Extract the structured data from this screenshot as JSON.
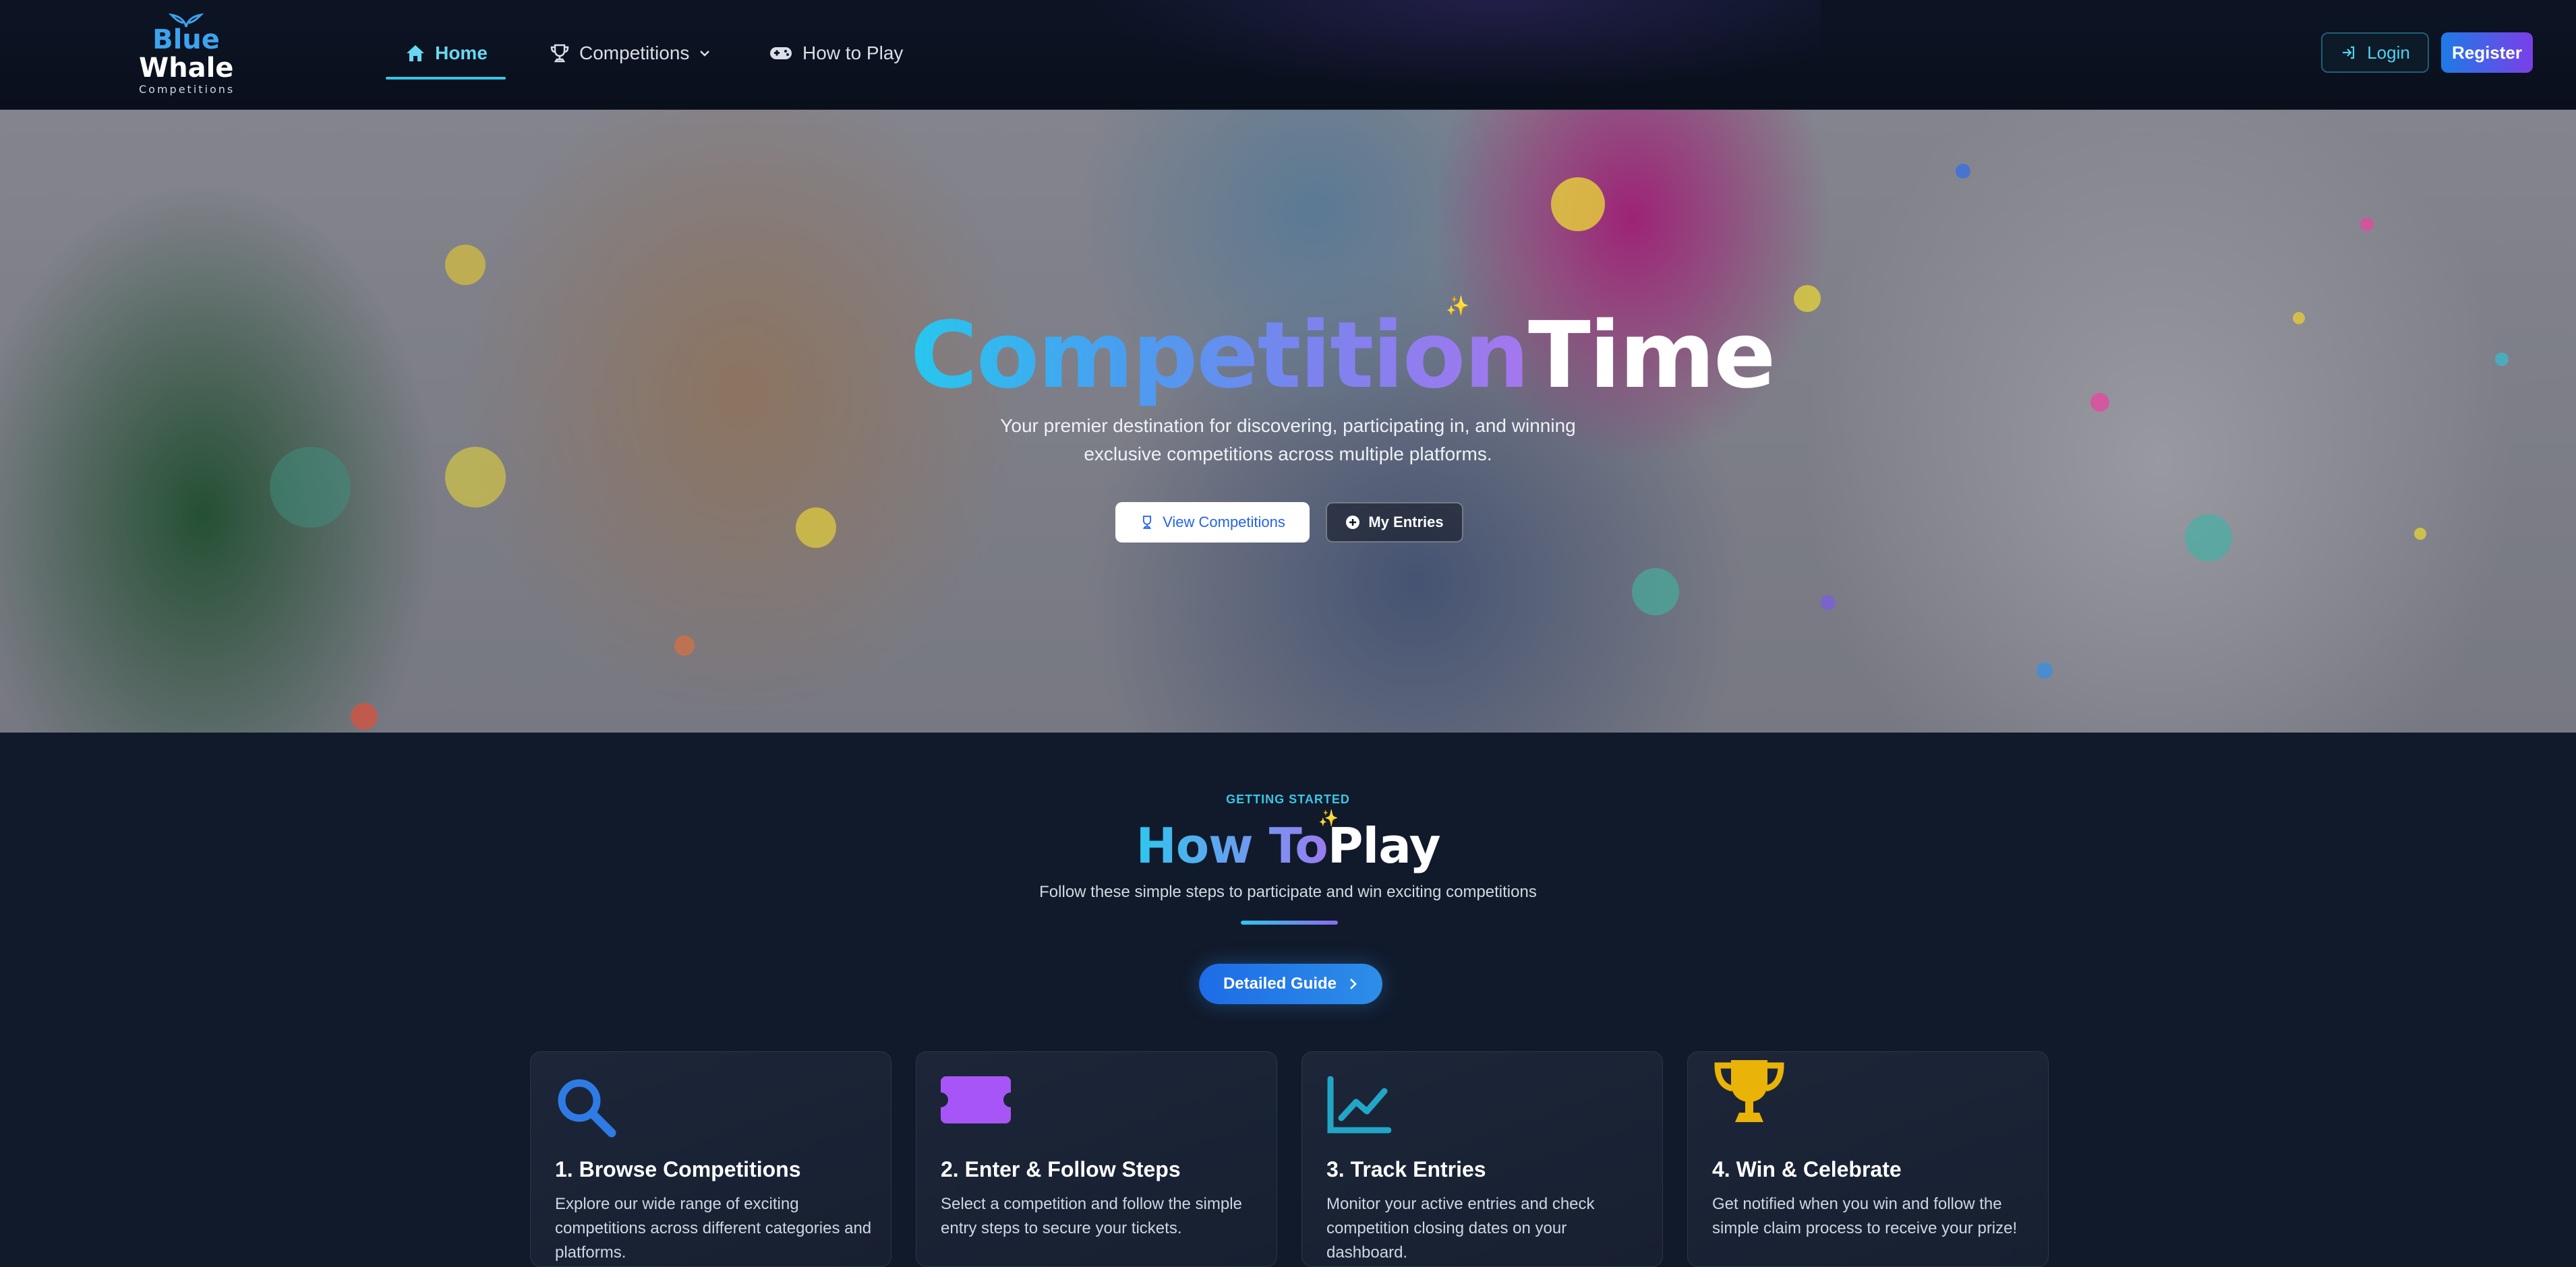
{
  "brand": {
    "line1": "Blue",
    "line2": "Whale",
    "line3": "Competitions"
  },
  "nav": {
    "home": "Home",
    "competitions": "Competitions",
    "how_to_play": "How to Play",
    "login": "Login",
    "register": "Register"
  },
  "hero": {
    "title_part1": "Competition",
    "title_part2": "Time",
    "subtitle": "Your premier destination for discovering, participating in, and winning exclusive competitions across multiple platforms.",
    "primary_button": "View Competitions",
    "secondary_button": "My Entries"
  },
  "how_to_play": {
    "eyebrow": "GETTING STARTED",
    "title_part1": "How To",
    "title_part2": "Play",
    "subtitle": "Follow these simple steps to participate and win exciting competitions",
    "guide_button": "Detailed Guide",
    "steps": [
      {
        "icon": "magnifier-icon",
        "title": "1. Browse Competitions",
        "desc": "Explore our wide range of exciting competitions across different categories and platforms."
      },
      {
        "icon": "ticket-icon",
        "title": "2. Enter & Follow Steps",
        "desc": "Select a competition and follow the simple entry steps to secure your tickets."
      },
      {
        "icon": "chart-line-icon",
        "title": "3. Track Entries",
        "desc": "Monitor your active entries and check competition closing dates on your dashboard."
      },
      {
        "icon": "trophy-icon",
        "title": "4. Win & Celebrate",
        "desc": "Get notified when you win and follow the simple claim process to receive your prize!"
      }
    ]
  },
  "colors": {
    "accent_cyan": "#35c6e6",
    "accent_purple": "#7a3fe8",
    "page_bg": "#111a2b",
    "ticket_purple": "#a855f7",
    "trophy_gold": "#eab308",
    "search_blue": "#2f7be6",
    "chart_cyan": "#22a6c8"
  }
}
